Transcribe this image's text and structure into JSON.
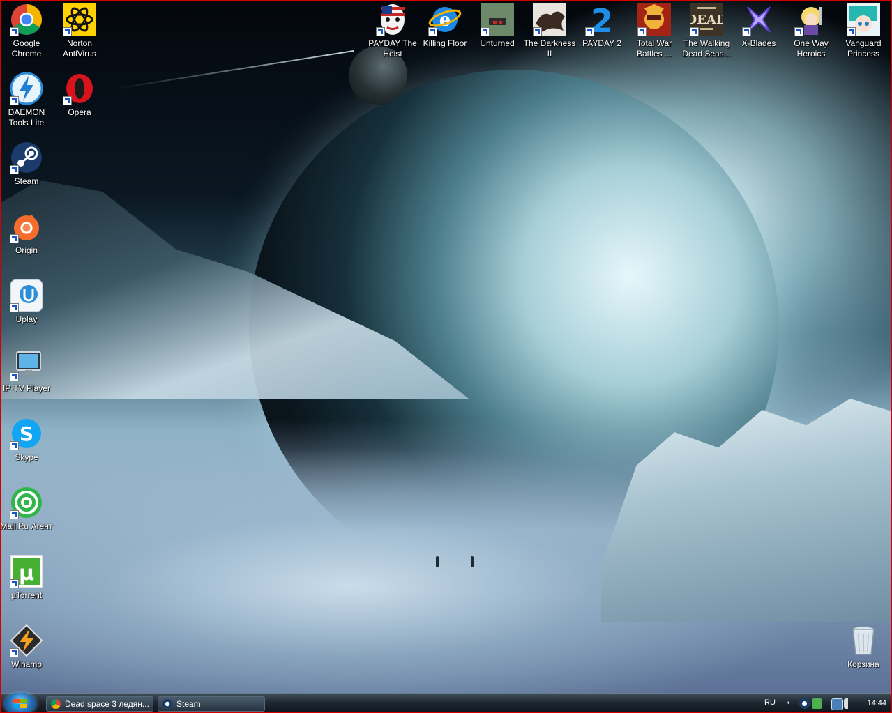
{
  "desktop": {
    "icons_left": [
      {
        "label": "Google Chrome",
        "icon": "chrome-icon"
      },
      {
        "label": "Norton AntiVirus",
        "icon": "norton-icon"
      },
      {
        "label": "DAEMON Tools Lite",
        "icon": "daemon-tools-icon"
      },
      {
        "label": "Opera",
        "icon": "opera-icon"
      },
      {
        "label": "Steam",
        "icon": "steam-icon"
      },
      {
        "label": "Origin",
        "icon": "origin-icon"
      },
      {
        "label": "Uplay",
        "icon": "uplay-icon"
      },
      {
        "label": "IP-TV Player",
        "icon": "iptv-icon"
      },
      {
        "label": "Skype",
        "icon": "skype-icon"
      },
      {
        "label": "Mail.Ru Агент",
        "icon": "mailru-agent-icon"
      },
      {
        "label": "µTorrent",
        "icon": "utorrent-icon"
      },
      {
        "label": "Winamp",
        "icon": "winamp-icon"
      }
    ],
    "icons_top": [
      {
        "label": "PAYDAY The Heist",
        "icon": "payday-heist-icon"
      },
      {
        "label": "Killing Floor",
        "icon": "killing-floor-icon"
      },
      {
        "label": "Unturned",
        "icon": "unturned-icon"
      },
      {
        "label": "The Darkness II",
        "icon": "darkness-2-icon"
      },
      {
        "label": "PAYDAY 2",
        "icon": "payday-2-icon"
      },
      {
        "label": "Total War Battles ...",
        "icon": "total-war-icon"
      },
      {
        "label": "The Walking Dead Seas...",
        "icon": "walking-dead-icon"
      },
      {
        "label": "X-Blades",
        "icon": "x-blades-icon"
      },
      {
        "label": "One Way Heroics",
        "icon": "one-way-heroics-icon"
      },
      {
        "label": "Vanguard Princess",
        "icon": "vanguard-princess-icon"
      }
    ],
    "recycle_bin": {
      "label": "Корзина",
      "icon": "recycle-bin-icon"
    }
  },
  "taskbar": {
    "tasks": [
      {
        "label": "Dead space 3 ледян...",
        "icon": "chrome-icon"
      },
      {
        "label": "Steam",
        "icon": "steam-icon"
      }
    ],
    "language": "RU",
    "clock": "14:44"
  },
  "colors": {
    "frame_border": "#d40000",
    "taskbar": "#1d2731"
  }
}
